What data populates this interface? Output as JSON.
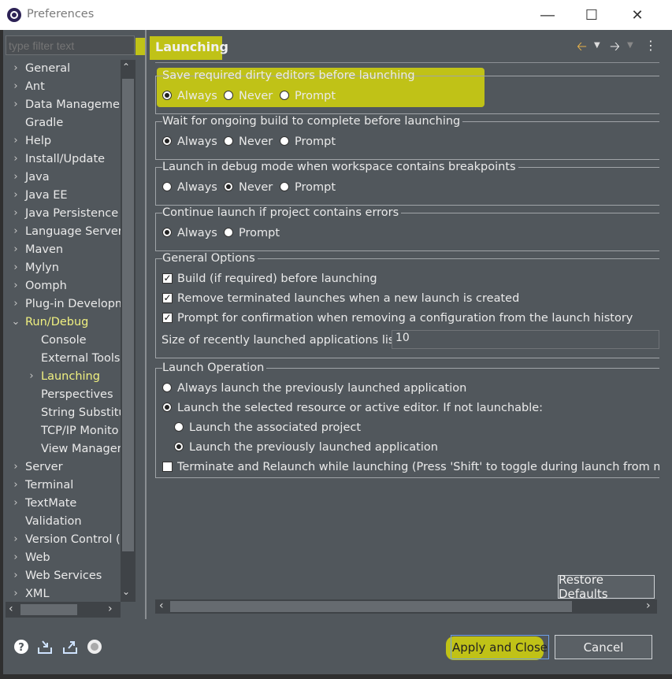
{
  "window": {
    "title": "Preferences",
    "minimize_glyph": "―",
    "maximize_glyph": "☐",
    "close_glyph": "✕"
  },
  "filter": {
    "placeholder": "type filter text"
  },
  "tree": [
    {
      "label": "General",
      "chevron": "›"
    },
    {
      "label": "Ant",
      "chevron": "›"
    },
    {
      "label": "Data Managemer",
      "chevron": "›"
    },
    {
      "label": "Gradle",
      "chevron": ""
    },
    {
      "label": "Help",
      "chevron": "›"
    },
    {
      "label": "Install/Update",
      "chevron": "›"
    },
    {
      "label": "Java",
      "chevron": "›"
    },
    {
      "label": "Java EE",
      "chevron": "›"
    },
    {
      "label": "Java Persistence",
      "chevron": "›"
    },
    {
      "label": "Language Servers",
      "chevron": "›"
    },
    {
      "label": "Maven",
      "chevron": "›"
    },
    {
      "label": "Mylyn",
      "chevron": "›"
    },
    {
      "label": "Oomph",
      "chevron": "›"
    },
    {
      "label": "Plug-in Developm",
      "chevron": "›"
    },
    {
      "label": "Run/Debug",
      "chevron": "⌄"
    },
    {
      "label": "Console",
      "chevron": ""
    },
    {
      "label": "External Tools",
      "chevron": ""
    },
    {
      "label": "Launching",
      "chevron": "›"
    },
    {
      "label": "Perspectives",
      "chevron": ""
    },
    {
      "label": "String Substitu",
      "chevron": ""
    },
    {
      "label": "TCP/IP Monito",
      "chevron": ""
    },
    {
      "label": "View Manager",
      "chevron": ""
    },
    {
      "label": "Server",
      "chevron": "›"
    },
    {
      "label": "Terminal",
      "chevron": "›"
    },
    {
      "label": "TextMate",
      "chevron": "›"
    },
    {
      "label": "Validation",
      "chevron": ""
    },
    {
      "label": "Version Control (",
      "chevron": "›"
    },
    {
      "label": "Web",
      "chevron": "›"
    },
    {
      "label": "Web Services",
      "chevron": "›"
    },
    {
      "label": "XML",
      "chevron": "›"
    }
  ],
  "page": {
    "title": "Launching",
    "groups": {
      "dirty": {
        "title": "Save required dirty editors before launching",
        "options": [
          "Always",
          "Never",
          "Prompt"
        ]
      },
      "build": {
        "title": "Wait for ongoing build to complete before launching",
        "options": [
          "Always",
          "Never",
          "Prompt"
        ]
      },
      "debug": {
        "title": "Launch in debug mode when workspace contains breakpoints",
        "options": [
          "Always",
          "Never",
          "Prompt"
        ]
      },
      "errors": {
        "title": "Continue launch if project contains errors",
        "options": [
          "Always",
          "Prompt"
        ]
      },
      "general": {
        "title": "General Options",
        "checks": [
          "Build (if required) before launching",
          "Remove terminated launches when a new launch is created",
          "Prompt for confirmation when removing a configuration from the launch history"
        ],
        "size_label": "Size of recently launched applications list:",
        "size_value": "10"
      },
      "operation": {
        "title": "Launch Operation",
        "opt1": "Always launch the previously launched application",
        "opt2": "Launch the selected resource or active editor. If not launchable:",
        "sub1": "Launch the associated project",
        "sub2": "Launch the previously launched application",
        "terminate": "Terminate and Relaunch while launching (Press 'Shift' to toggle during launch from menu)"
      }
    },
    "restore_defaults": "Restore Defaults"
  },
  "footer": {
    "apply_close": "Apply and Close",
    "cancel": "Cancel"
  },
  "colors": {
    "highlight": "#e6e600",
    "panel": "#51575c"
  }
}
